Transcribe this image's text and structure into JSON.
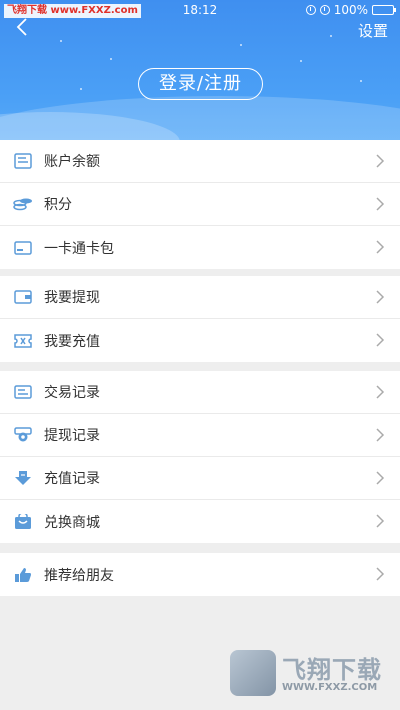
{
  "status_bar": {
    "watermark": "飞翔下载 www.FXXZ.com",
    "time": "18:12",
    "battery": "100%"
  },
  "header": {
    "back_icon": "chevron-left-icon",
    "settings_label": "设置",
    "login_label": "登录/注册"
  },
  "groups": [
    {
      "items": [
        {
          "label": "账户余额",
          "icon": "document-icon"
        },
        {
          "label": "积分",
          "icon": "coins-icon"
        },
        {
          "label": "一卡通卡包",
          "icon": "card-icon"
        }
      ]
    },
    {
      "items": [
        {
          "label": "我要提现",
          "icon": "wallet-icon"
        },
        {
          "label": "我要充值",
          "icon": "ticket-icon"
        }
      ]
    },
    {
      "items": [
        {
          "label": "交易记录",
          "icon": "message-icon"
        },
        {
          "label": "提现记录",
          "icon": "withdraw-icon"
        },
        {
          "label": "充值记录",
          "icon": "download-icon"
        },
        {
          "label": "兑换商城",
          "icon": "shop-bag-icon"
        }
      ]
    },
    {
      "items": [
        {
          "label": "推荐给朋友",
          "icon": "thumbs-up-icon"
        }
      ]
    }
  ],
  "watermark": {
    "brand": "飞翔下载",
    "url": "WWW.FXXZ.COM"
  },
  "colors": {
    "header_blue": "#4a9af3",
    "icon_blue": "#5b9bd9",
    "background": "#eeeeee"
  }
}
